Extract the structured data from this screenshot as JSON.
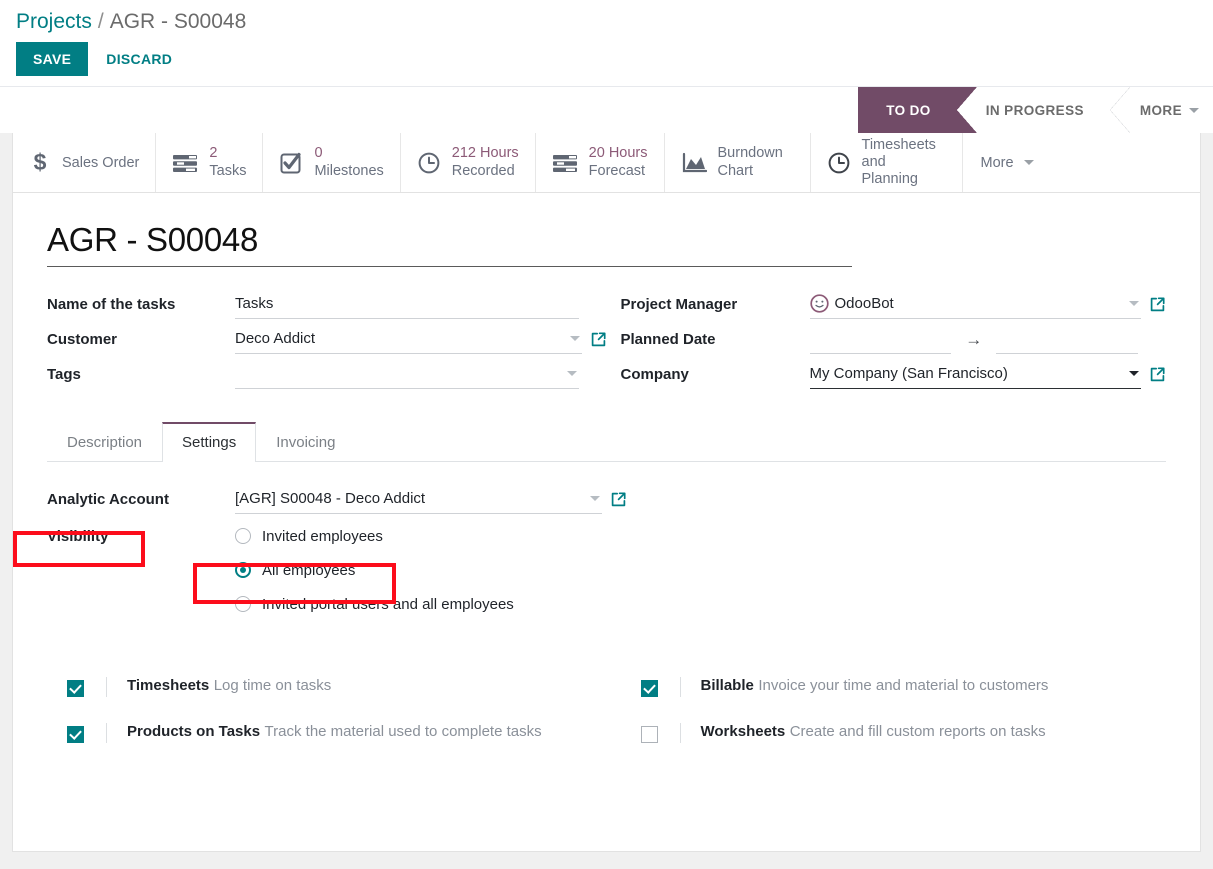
{
  "breadcrumb": {
    "root": "Projects",
    "separator": "/",
    "current": "AGR - S00048"
  },
  "actions": {
    "save_label": "SAVE",
    "discard_label": "DISCARD"
  },
  "statusbar": {
    "stages": [
      {
        "label": "TO DO",
        "active": true
      },
      {
        "label": "IN PROGRESS",
        "active": false
      }
    ],
    "more_label": "MORE"
  },
  "smart_buttons": [
    {
      "icon": "dollar-icon",
      "value": "",
      "label": "Sales Order"
    },
    {
      "icon": "bars-icon",
      "value": "2",
      "label": "Tasks"
    },
    {
      "icon": "check-square-icon",
      "value": "0",
      "label": "Milestones"
    },
    {
      "icon": "clock-icon",
      "value": "212 Hours",
      "label": "Recorded"
    },
    {
      "icon": "bars-icon",
      "value": "20 Hours",
      "label": "Forecast"
    },
    {
      "icon": "area-chart-icon",
      "value": "",
      "label": "Burndown Chart"
    },
    {
      "icon": "clock-icon",
      "value": "",
      "label": "Timesheets and Planning"
    }
  ],
  "smart_more_label": "More",
  "record": {
    "title": "AGR - S00048"
  },
  "form": {
    "left": [
      {
        "label": "Name of the tasks",
        "value": "Tasks",
        "placeholder": ""
      },
      {
        "label": "Customer",
        "value": "Deco Addict",
        "placeholder": ""
      },
      {
        "label": "Tags",
        "value": "",
        "placeholder": ""
      }
    ],
    "right": {
      "project_manager_label": "Project Manager",
      "project_manager_value": "OdooBot",
      "planned_date_label": "Planned Date",
      "planned_date_start": "",
      "planned_date_end": "",
      "planned_date_arrow": "→",
      "company_label": "Company",
      "company_value": "My Company (San Francisco)"
    }
  },
  "notebook": {
    "tabs": [
      {
        "label": "Description",
        "active": false
      },
      {
        "label": "Settings",
        "active": true
      },
      {
        "label": "Invoicing",
        "active": false
      }
    ]
  },
  "settings_page": {
    "analytic_account_label": "Analytic Account",
    "analytic_account_value": "[AGR] S00048 - Deco Addict",
    "visibility_label": "Visibility",
    "visibility_options": [
      {
        "label": "Invited employees",
        "checked": false
      },
      {
        "label": "All employees",
        "checked": true
      },
      {
        "label": "Invited portal users and all employees",
        "checked": false
      }
    ],
    "features_left": [
      {
        "title": "Timesheets",
        "desc": "Log time on tasks",
        "checked": true
      },
      {
        "title": "Products on Tasks",
        "desc": "Track the material used to complete tasks",
        "checked": true
      }
    ],
    "features_right": [
      {
        "title": "Billable",
        "desc": "Invoice your time and material to customers",
        "checked": true
      },
      {
        "title": "Worksheets",
        "desc": "Create and fill custom reports on tasks",
        "checked": false
      }
    ]
  },
  "colors": {
    "brand_teal": "#017e84",
    "stage_purple": "#714B67",
    "smart_value_purple": "#8c5a77",
    "annotation_red": "#fc0d1b"
  }
}
